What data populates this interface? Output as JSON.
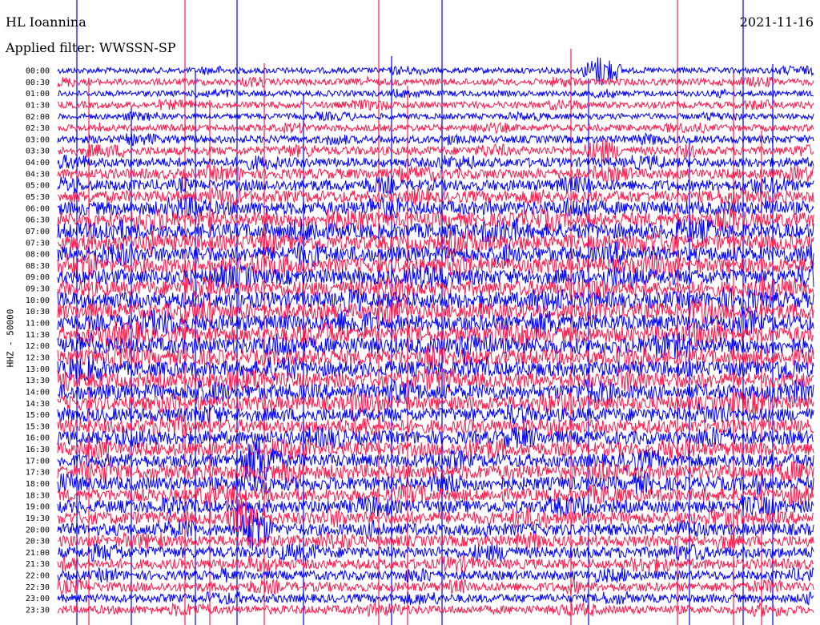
{
  "header": {
    "station": "HL Ioannina",
    "date": "2021-11-16",
    "filter": "Applied filter: WWSSN-SP"
  },
  "chart_data": {
    "type": "line",
    "title": "HL Ioannina",
    "ylabel": "HHZ - 50000",
    "row_labels": [
      "00:00",
      "00:30",
      "01:00",
      "01:30",
      "02:00",
      "02:30",
      "03:00",
      "03:30",
      "04:00",
      "04:30",
      "05:00",
      "05:30",
      "06:00",
      "06:30",
      "07:00",
      "07:30",
      "08:00",
      "08:30",
      "09:00",
      "09:30",
      "10:00",
      "10:30",
      "11:00",
      "11:30",
      "12:00",
      "12:30",
      "13:00",
      "13:30",
      "14:00",
      "14:30",
      "15:00",
      "15:30",
      "16:00",
      "16:30",
      "17:00",
      "17:30",
      "18:00",
      "18:30",
      "19:00",
      "19:30",
      "20:00",
      "20:30",
      "21:00",
      "21:30",
      "22:00",
      "22:30",
      "23:00",
      "23:30"
    ],
    "series_colors": [
      "#0000ff",
      "#ff1a4b"
    ],
    "activity_level": [
      0.15,
      0.2,
      0.15,
      0.2,
      0.15,
      0.2,
      0.25,
      0.3,
      0.35,
      0.4,
      0.45,
      0.5,
      0.6,
      0.65,
      0.7,
      0.7,
      0.7,
      0.7,
      0.7,
      0.7,
      0.75,
      0.75,
      0.75,
      0.75,
      0.75,
      0.7,
      0.7,
      0.7,
      0.7,
      0.65,
      0.6,
      0.6,
      0.6,
      0.6,
      0.6,
      0.65,
      0.6,
      0.55,
      0.55,
      0.55,
      0.5,
      0.45,
      0.45,
      0.4,
      0.35,
      0.35,
      0.3,
      0.3
    ],
    "events": [
      {
        "row": "17:00",
        "time_fraction": 0.27,
        "strength": 1.0
      },
      {
        "row": "19:30",
        "time_fraction": 0.25,
        "strength": 1.0
      },
      {
        "row": "20:00",
        "time_fraction": 0.26,
        "strength": 0.9
      },
      {
        "row": "00:00",
        "time_fraction": 0.72,
        "strength": 0.6
      },
      {
        "row": "03:30",
        "time_fraction": 0.72,
        "strength": 0.5
      }
    ]
  }
}
